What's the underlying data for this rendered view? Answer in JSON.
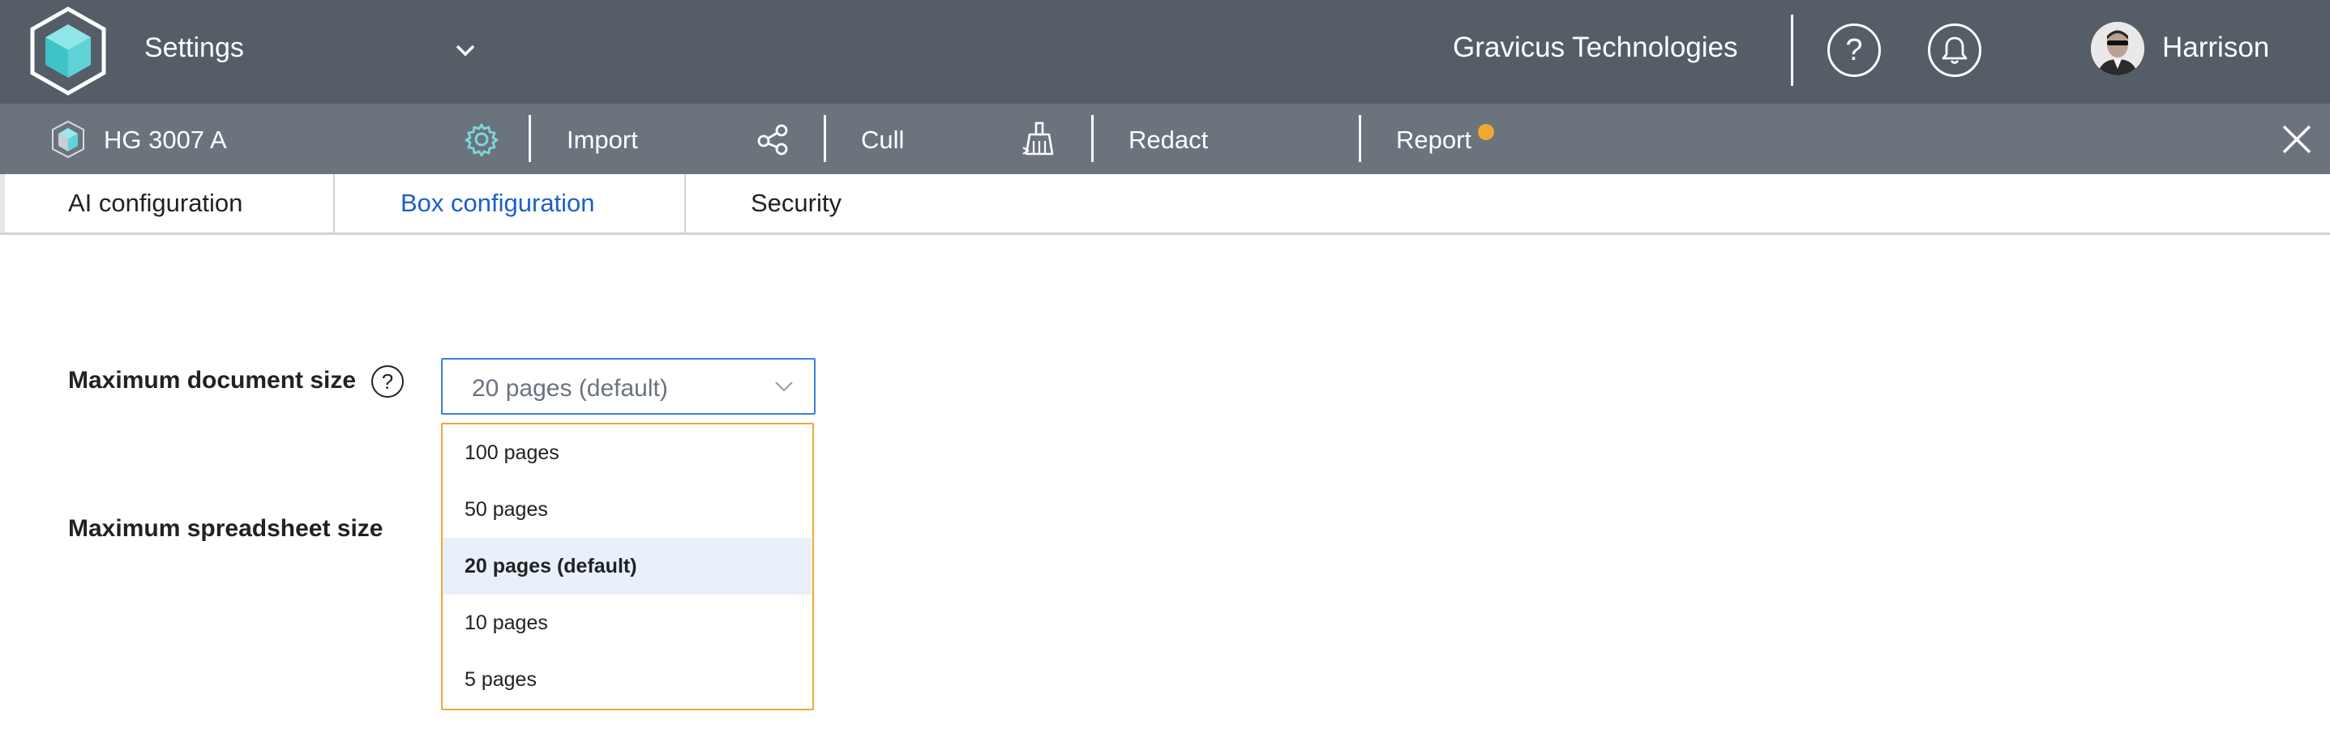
{
  "header": {
    "app_title": "Settings",
    "company": "Gravicus Technologies",
    "user_name": "Harrison"
  },
  "subnav": {
    "project_name": "HG 3007 A",
    "items": [
      {
        "label": "Import",
        "icon": "share-nodes-icon"
      },
      {
        "label": "Cull",
        "icon": "broom-icon"
      },
      {
        "label": "Redact"
      },
      {
        "label": "Report"
      }
    ],
    "report_badge_color": "#f0a830"
  },
  "tabs": [
    {
      "label": "AI configuration"
    },
    {
      "label": "Box configuration",
      "active": true
    },
    {
      "label": "Security"
    }
  ],
  "form": {
    "document_size": {
      "label": "Maximum document size",
      "value": "20 pages (default)",
      "options": [
        "100 pages",
        "50 pages",
        "20 pages (default)",
        "10 pages",
        "5 pages"
      ]
    },
    "spreadsheet_size": {
      "label": "Maximum spreadsheet size"
    }
  },
  "colors": {
    "topbar": "#555d67",
    "subbar": "#6b737c",
    "accent_blue": "#1d5fc7",
    "logo_teal": "#5fd3d6",
    "dropdown_border": "#f0a830",
    "selected_option_bg": "#e8f1fb"
  }
}
